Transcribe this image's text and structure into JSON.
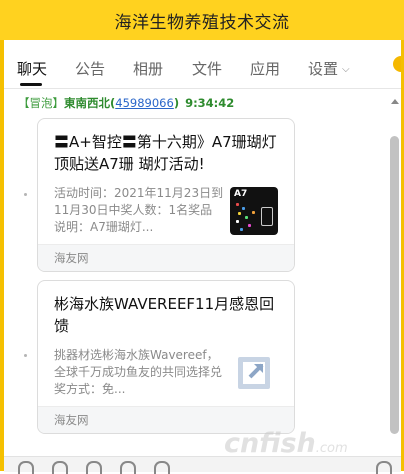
{
  "window": {
    "title": "海洋生物养殖技术交流"
  },
  "tabs": [
    {
      "label": "聊天",
      "active": true
    },
    {
      "label": "公告"
    },
    {
      "label": "相册"
    },
    {
      "label": "文件"
    },
    {
      "label": "应用"
    },
    {
      "label": "设置"
    }
  ],
  "message": {
    "tag": "【冒泡】",
    "nick": "東南西北",
    "qq_open": "(",
    "qq": "45989066",
    "qq_close": ")",
    "time": "9:34:42"
  },
  "cards": [
    {
      "title": "〓A+智控〓第十六期》A7珊瑚灯顶贴送A7珊 瑚灯活动!",
      "description": "活动时间：2021年11月23日到11月30日中奖人数：1名奖品说明：A7珊瑚灯...",
      "source": "海友网",
      "thumb_text": "A7",
      "thumb_icon": "a7-coral-lamp-thumbnail"
    },
    {
      "title": "彬海水族WAVEREEF11月感恩回馈",
      "description": "挑器材选彬海水族Wavereef，全球千万成功鱼友的共同选择兑奖方式：免...",
      "source": "海友网",
      "thumb_icon": "external-link-icon"
    }
  ],
  "watermark": {
    "text": "cnfish",
    "suffix": ".com"
  },
  "colors": {
    "title_bar": "#ffd21f",
    "frame": "#f5c000",
    "nick_green": "#2e8b2e",
    "link_blue": "#2a66c9"
  }
}
